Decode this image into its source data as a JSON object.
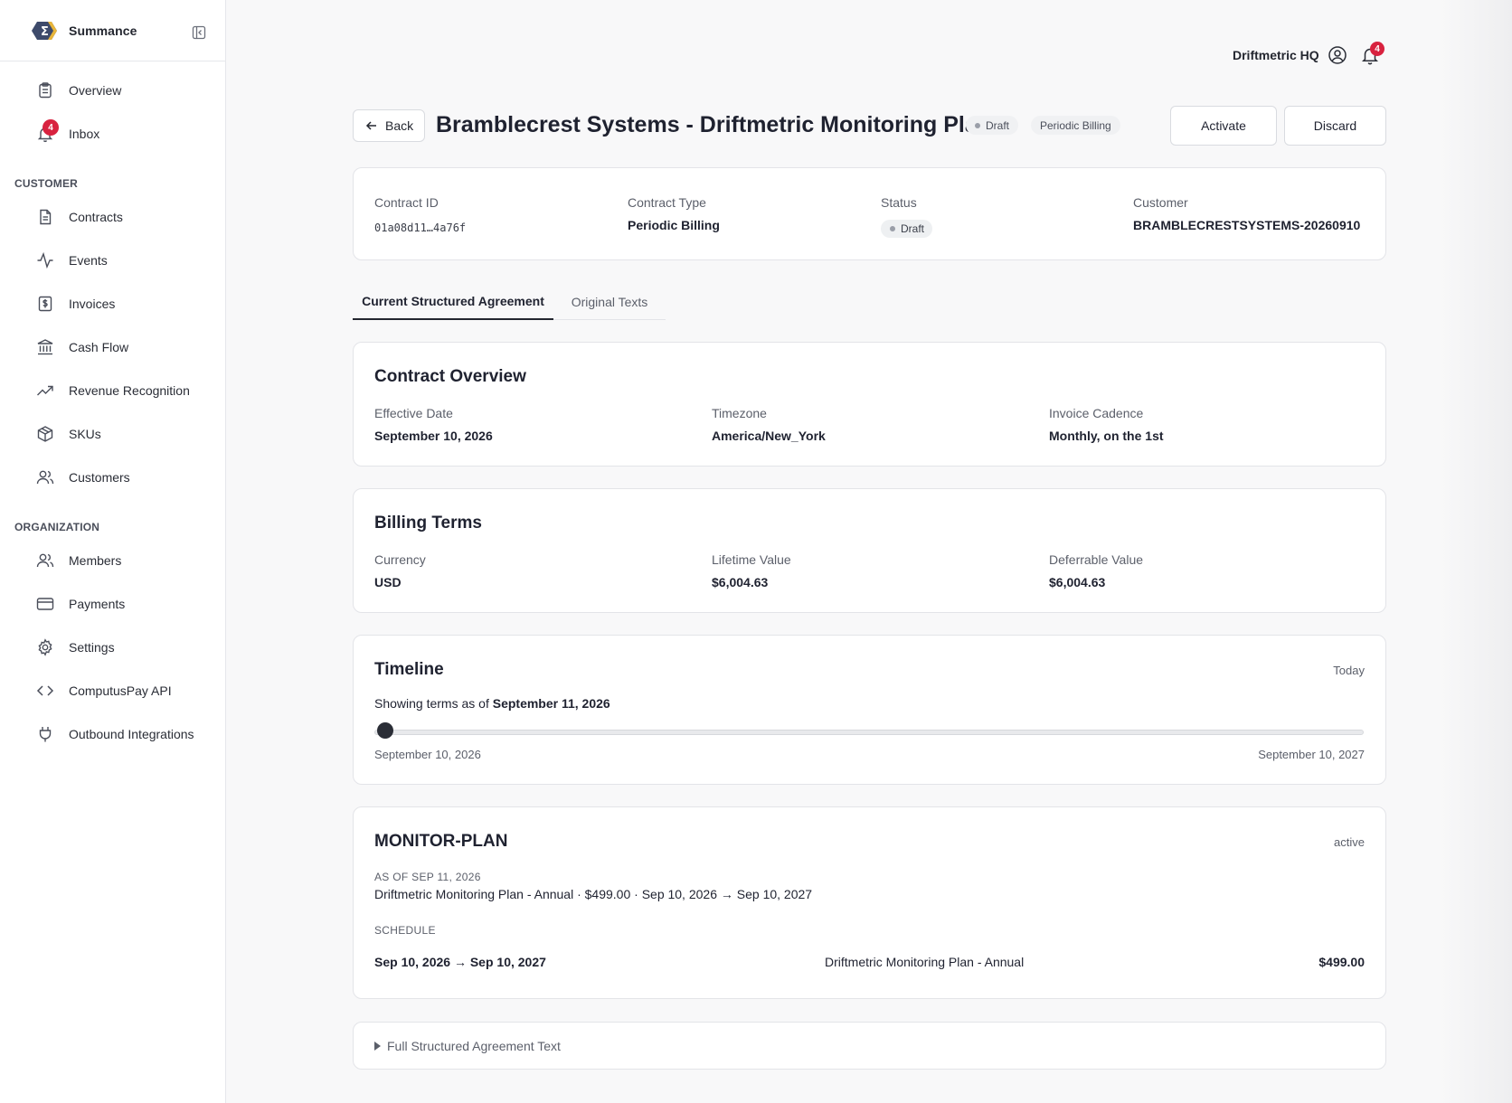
{
  "app": {
    "name": "Summance"
  },
  "sidebar": {
    "top_items": [
      {
        "label": "Overview",
        "icon": "clipboard-icon"
      },
      {
        "label": "Inbox",
        "icon": "bell-icon",
        "badge": "4"
      }
    ],
    "customer_section": "CUSTOMER",
    "customer_items": [
      {
        "label": "Contracts",
        "icon": "document-icon"
      },
      {
        "label": "Events",
        "icon": "activity-icon"
      },
      {
        "label": "Invoices",
        "icon": "dollar-receipt-icon"
      },
      {
        "label": "Cash Flow",
        "icon": "bank-icon"
      },
      {
        "label": "Revenue Recognition",
        "icon": "trending-up-icon"
      },
      {
        "label": "SKUs",
        "icon": "package-icon"
      },
      {
        "label": "Customers",
        "icon": "users-icon"
      }
    ],
    "organization_section": "ORGANIZATION",
    "organization_items": [
      {
        "label": "Members",
        "icon": "users-icon"
      },
      {
        "label": "Payments",
        "icon": "credit-card-icon"
      },
      {
        "label": "Settings",
        "icon": "gear-icon"
      },
      {
        "label": "ComputusPay API",
        "icon": "code-icon"
      },
      {
        "label": "Outbound Integrations",
        "icon": "plug-icon"
      }
    ]
  },
  "topbar": {
    "org_name": "Driftmetric HQ",
    "notification_count": "4"
  },
  "header": {
    "back_label": "Back",
    "title": "Bramblecrest Systems - Driftmetric Monitoring Plan",
    "status_pill": "Draft",
    "type_pill": "Periodic Billing",
    "activate_label": "Activate",
    "discard_label": "Discard"
  },
  "summary": {
    "contract_id_label": "Contract ID",
    "contract_id": "01a08d11…4a76f",
    "contract_type_label": "Contract Type",
    "contract_type": "Periodic Billing",
    "status_label": "Status",
    "status": "Draft",
    "customer_label": "Customer",
    "customer": "BRAMBLECRESTSYSTEMS-20260910"
  },
  "tabs": [
    {
      "label": "Current Structured Agreement",
      "active": true
    },
    {
      "label": "Original Texts",
      "active": false
    }
  ],
  "overview": {
    "title": "Contract Overview",
    "effective_date_label": "Effective Date",
    "effective_date": "September 10, 2026",
    "timezone_label": "Timezone",
    "timezone": "America/New_York",
    "cadence_label": "Invoice Cadence",
    "cadence": "Monthly, on the 1st"
  },
  "billing": {
    "title": "Billing Terms",
    "currency_label": "Currency",
    "currency": "USD",
    "lifetime_label": "Lifetime Value",
    "lifetime": "$6,004.63",
    "deferrable_label": "Deferrable Value",
    "deferrable": "$6,004.63"
  },
  "timeline": {
    "title": "Timeline",
    "today_label": "Today",
    "showing_prefix": "Showing terms as of",
    "showing_date": "September 11, 2026",
    "start_label": "September 10, 2026",
    "end_label": "September 10, 2027",
    "position_fraction": 0.003
  },
  "plan": {
    "title": "MONITOR-PLAN",
    "state": "active",
    "as_of_label": "AS OF SEP 11, 2026",
    "as_of_line": "Driftmetric Monitoring Plan - Annual · $499.00 · Sep 10, 2026 → Sep 10, 2027",
    "schedule_label": "SCHEDULE",
    "schedule_period": "Sep 10, 2026 → Sep 10, 2027",
    "schedule_item": "Driftmetric Monitoring Plan - Annual",
    "schedule_amount": "$499.00"
  },
  "full_text": {
    "label": "Full Structured Agreement Text"
  }
}
